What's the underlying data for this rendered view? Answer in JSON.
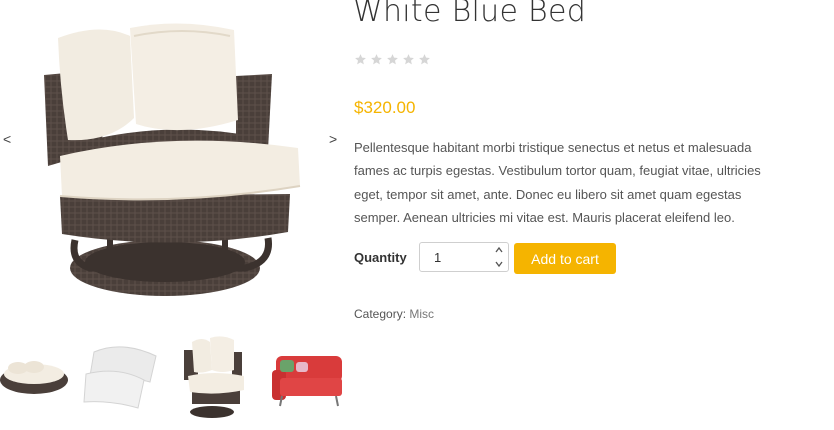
{
  "gallery": {
    "prev_arrow": "<",
    "next_arrow": ">",
    "thumbnails": [
      {
        "name": "thumb-daybed"
      },
      {
        "name": "thumb-pillows"
      },
      {
        "name": "thumb-swivel-chair"
      },
      {
        "name": "thumb-red-sofa"
      }
    ]
  },
  "product": {
    "title": "White Blue Bed",
    "rating": 0,
    "rating_max": 5,
    "price": "$320.00",
    "description": "Pellentesque habitant morbi tristique senectus et netus et malesuada fames ac turpis egestas. Vestibulum tortor quam, feugiat vitae, ultricies eget, tempor sit amet, ante. Donec eu libero sit amet quam egestas semper. Aenean ultricies mi vitae est. Mauris placerat eleifend leo.",
    "quantity_label": "Quantity",
    "quantity_value": "1",
    "add_to_cart_label": "Add to cart",
    "category_label": "Category:",
    "category_value": "Misc"
  },
  "colors": {
    "accent": "#f5b400",
    "star_empty": "#d6d6d6",
    "wicker": "#4a3f3a",
    "cushion": "#f3ede2",
    "sofa_red": "#d93b3b"
  },
  "icons": {
    "star": "star-icon",
    "spin_up": "chevron-up-icon",
    "spin_down": "chevron-down-icon"
  }
}
